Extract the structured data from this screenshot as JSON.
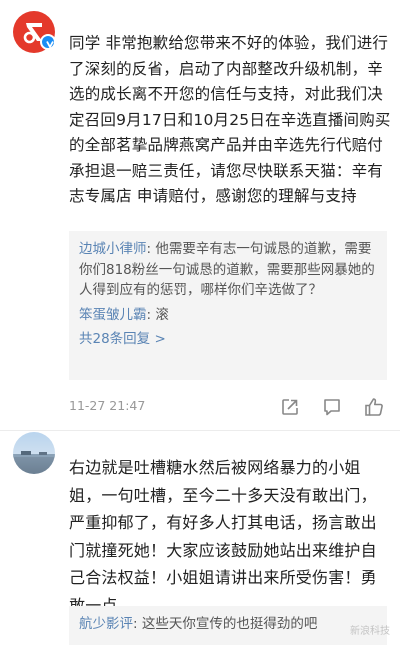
{
  "comment1": {
    "text": "同学 非常抱歉给您带来不好的体验，我们进行了深刻的反省，启动了内部整改升级机制，辛选的成长离不开您的信任与支持，对此我们决定召回9月17日和10月25日在辛选直播间购买的全部茗挚品牌燕窝产品并由辛选先行代赔付承担退一赔三责任，请您尽快联系天猫：辛有志专属店 申请赔付，感谢您的理解与支持",
    "replies": [
      {
        "user": "边城小律师",
        "text": "他需要辛有志一句诚恳的道歉，需要你们818粉丝一句诚恳的道歉，需要那些网暴她的人得到应有的惩罚，哪样你们辛选做了？"
      },
      {
        "user": "笨蛋皱儿霸",
        "text": "滚"
      }
    ],
    "more_replies": "共28条回复 >",
    "timestamp": "11-27 21:47"
  },
  "comment2": {
    "text": "右边就是吐槽糖水然后被网络暴力的小姐姐，一句吐槽，至今二十多天没有敢出门，严重抑郁了，有好多人打其电话，扬言敢出门就撞死她！大家应该鼓励她站出来维护自己合法权益！小姐姐请讲出来所受伤害！勇敢一点",
    "replies": [
      {
        "user": "航少影评",
        "text": "这些天你宣传的也挺得劲的吧"
      }
    ]
  },
  "watermark": "新浪科技",
  "icons": [
    "share-icon",
    "comment-icon",
    "like-icon"
  ],
  "colors": {
    "brand": "#e4392b",
    "verified": "#1a8ef5",
    "link": "#5a84b4"
  }
}
